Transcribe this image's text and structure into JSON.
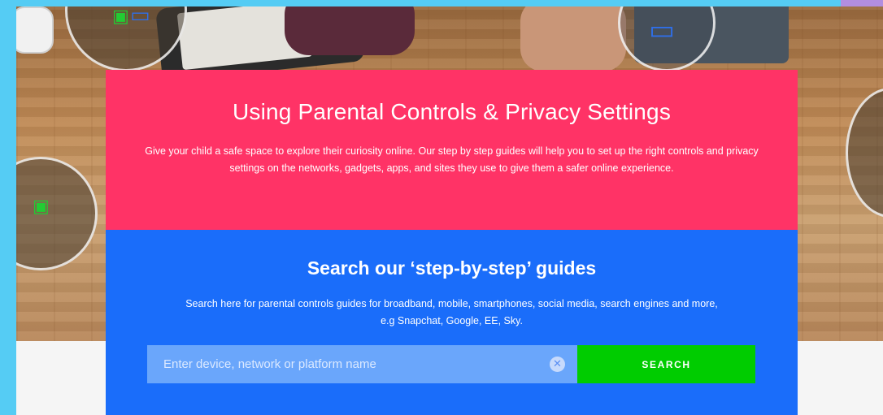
{
  "hero": {
    "title": "Using Parental Controls & Privacy Settings",
    "description": "Give your child a safe space to explore their curiosity online. Our step by step guides will help you to set up the right controls and privacy settings on the networks, gadgets, apps, and sites they use to give them a safer online experience."
  },
  "search": {
    "title": "Search our ‘step-by-step’ guides",
    "description": "Search here for parental controls guides for broadband, mobile, smartphones, social media, search engines and more, e.g Snapchat, Google, EE, Sky.",
    "placeholder": "Enter device, network or platform name",
    "value": "",
    "clear_icon": "✕",
    "button_label": "SEARCH"
  },
  "icons": {
    "green_device": "▣",
    "blue_tablet": "▭",
    "blue_laptop": "▭",
    "green_laptop": "▣"
  },
  "colors": {
    "frame": "#55ccf4",
    "pink_card": "#ff3366",
    "blue_card": "#1a6dfa",
    "search_button": "#00cc00",
    "input_background": "#6aa6fb"
  }
}
